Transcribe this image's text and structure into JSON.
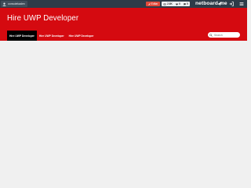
{
  "adminbar": {
    "user_name": "consolekadev",
    "edit_label": "Editar",
    "stats": [
      {
        "icon": "eye-icon",
        "value": "2.6K"
      },
      {
        "icon": "heart-icon",
        "value": "0"
      },
      {
        "icon": "comment-icon",
        "value": "0"
      }
    ],
    "brand": "netboard.me",
    "icons": [
      "share-icon",
      "login-icon",
      "menu-icon"
    ]
  },
  "header": {
    "title": "Hire UWP Developer",
    "background_color": "#d50a10",
    "nav": [
      {
        "label": "Hire UWP Developer",
        "active": true
      },
      {
        "label": "Hire UWP Developer",
        "active": false
      },
      {
        "label": "Hire UWP Developer",
        "active": false
      }
    ],
    "search_placeholder": "Search"
  }
}
